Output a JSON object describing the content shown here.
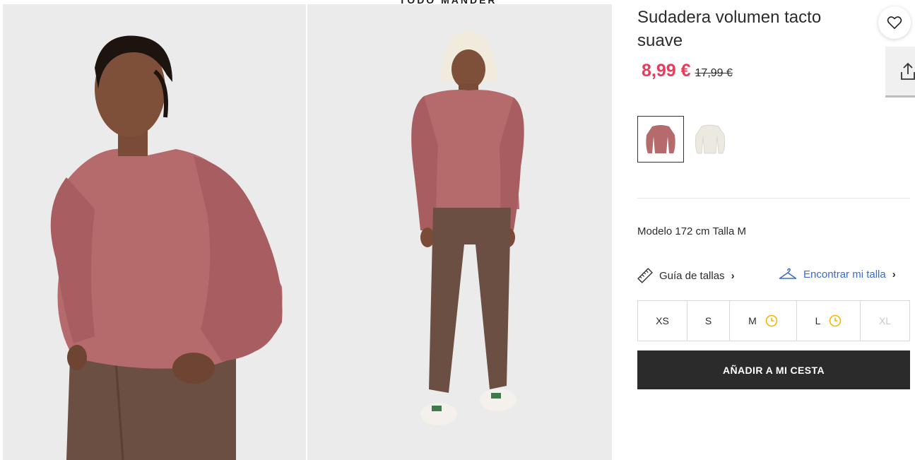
{
  "product": {
    "title": "Sudadera volumen tacto suave",
    "price_current": "8,99 €",
    "price_original": "17,99 €",
    "model_info": "Modelo 172 cm Talla M",
    "colors": [
      {
        "name": "rosa",
        "hex": "#b56a6c",
        "selected": true
      },
      {
        "name": "crudo",
        "hex": "#ece9e1",
        "selected": false
      }
    ]
  },
  "banner": {
    "partial_text": "TODO MANDER"
  },
  "links": {
    "size_guide": "Guía de tallas",
    "find_size": "Encontrar mi talla"
  },
  "sizes": [
    {
      "label": "XS",
      "low_stock": false,
      "available": true
    },
    {
      "label": "S",
      "low_stock": false,
      "available": true
    },
    {
      "label": "M",
      "low_stock": true,
      "available": true
    },
    {
      "label": "L",
      "low_stock": true,
      "available": true
    },
    {
      "label": "XL",
      "low_stock": false,
      "available": false
    }
  ],
  "cart": {
    "add_label": "AÑADIR A MI CESTA"
  },
  "icons": {
    "favorite": "heart-icon",
    "share": "share-icon",
    "size_guide": "ruler-icon",
    "find_size": "hanger-icon",
    "low_stock": "clock-icon"
  },
  "colors": {
    "sale_price": "#e73c5b",
    "link_blue": "#3c6bc9",
    "button_dark": "#2b2b2b",
    "clock_yellow": "#f2b705"
  }
}
